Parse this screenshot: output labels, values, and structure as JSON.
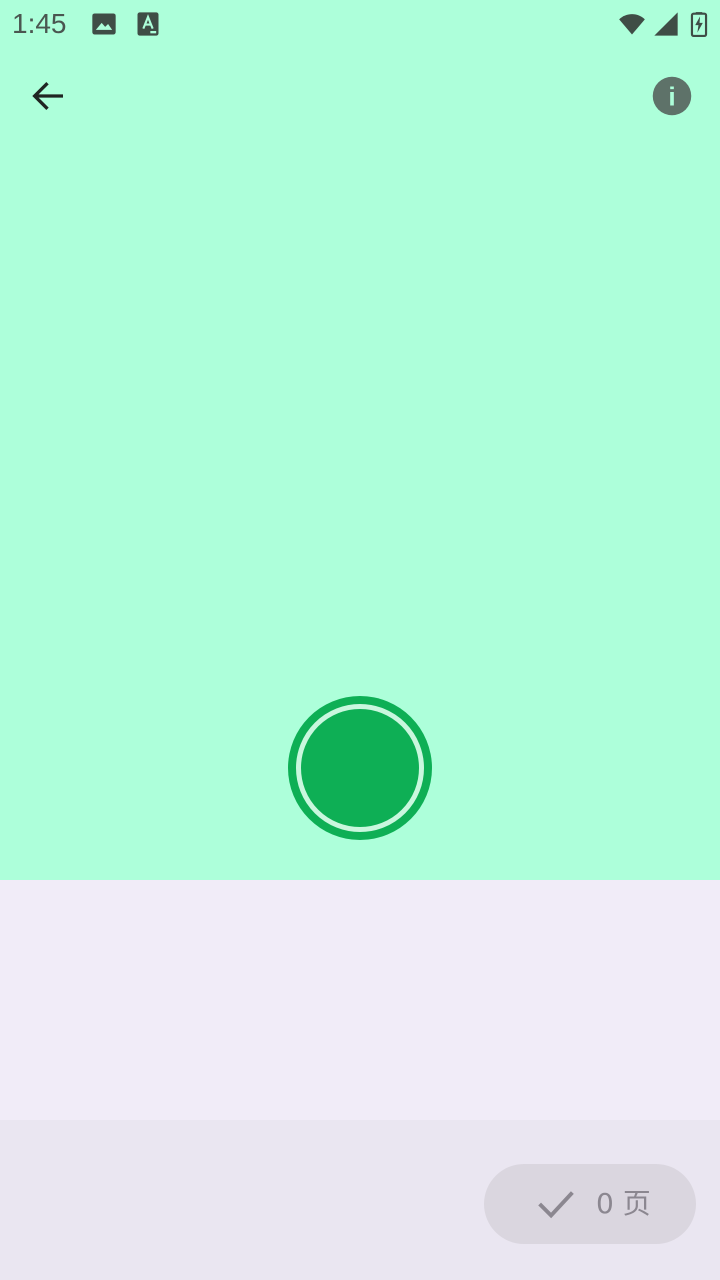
{
  "status_bar": {
    "time": "1:45",
    "left_icons": [
      "image-notification-icon",
      "font-notification-icon"
    ],
    "right_icons": [
      "wifi-icon",
      "cell-signal-icon",
      "battery-charging-icon"
    ]
  },
  "top_bar": {
    "back_icon": "arrow-left-icon",
    "info_icon": "info-icon",
    "info_glyph": "i"
  },
  "camera": {
    "shutter_icon": "shutter-icon"
  },
  "bottom_bar": {
    "done_icon": "check-icon",
    "page_count_label": "0 页"
  },
  "colors": {
    "camera_background": "#ADFFDA",
    "shutter": "#0EAF55",
    "thumbnail_background": "#F1ECF8",
    "bottom_bar_background": "#EAE6F1",
    "done_button_background": "#DAD6DF",
    "done_button_text": "#8B8790",
    "info_icon_background": "#5E7269"
  }
}
